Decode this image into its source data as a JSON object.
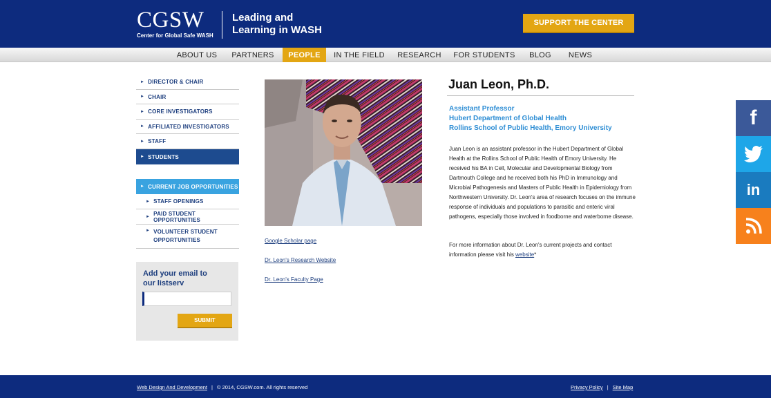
{
  "header": {
    "logo_text": "CGSW",
    "logo_subtitle": "Center for Global Safe WASH",
    "tagline_line1": "Leading and",
    "tagline_line2": "Learning in WASH",
    "support_button": "SUPPORT THE CENTER"
  },
  "nav": {
    "items": [
      {
        "label": "ABOUT US"
      },
      {
        "label": "PARTNERS"
      },
      {
        "label": "PEOPLE"
      },
      {
        "label": "IN THE FIELD"
      },
      {
        "label": "RESEARCH"
      },
      {
        "label": "FOR STUDENTS"
      },
      {
        "label": "BLOG"
      },
      {
        "label": "NEWS"
      }
    ],
    "active": "PEOPLE"
  },
  "sidebar": {
    "people_links": [
      {
        "label": "DIRECTOR & CHAIR"
      },
      {
        "label": "CHAIR"
      },
      {
        "label": "CORE INVESTIGATORS"
      },
      {
        "label": "AFFILIATED INVESTIGATORS"
      },
      {
        "label": "STAFF"
      },
      {
        "label": "STUDENTS"
      }
    ],
    "jobs_heading": "CURRENT JOB OPPORTUNITIES",
    "job_links": [
      {
        "label": "STAFF OPENINGS"
      },
      {
        "label": "PAID STUDENT OPPORTUNITIES"
      },
      {
        "label": "VOLUNTEER STUDENT OPPORTUNITIES"
      }
    ],
    "listserv": {
      "title_line1": "Add your email to",
      "title_line2": "our listserv",
      "input_value": "",
      "submit_label": "SUBMIT"
    }
  },
  "profile": {
    "name": "Juan Leon, Ph.D.",
    "titles": [
      "Assistant Professor",
      "Hubert Department of Global Health",
      "Rollins School of Public Health, Emory University"
    ],
    "bio": "Juan Leon is an assistant professor in the Hubert Department of Global Health at the Rollins School of Public Health of Emory University. He received his BA in Cell, Molecular and Developmental Biology from Dartmouth College and he received both his PhD in Immunology and Microbial Pathogenesis and Masters of Public Health in Epidemiology from Northwestern University. Dr. Leon's area of research focuses on the immune response of individuals and populations to parasitic and enteric viral pathogens, especially those involved in foodborne and waterborne disease.",
    "more_info_prefix": "For more information about Dr. Leon's current projects and contact information please visit his ",
    "more_info_link": "website",
    "more_info_suffix": "*",
    "links": [
      {
        "label": "Google Scholar page"
      },
      {
        "label": "Dr. Leon's Research Website"
      },
      {
        "label": "Dr. Leon's Faculty Page"
      }
    ]
  },
  "social": {
    "facebook": {
      "glyph": "f",
      "color": "#3b5999"
    },
    "twitter": {
      "color": "#1ea6e8"
    },
    "linkedin": {
      "glyph": "in",
      "color": "#1a7bbf"
    },
    "rss": {
      "color": "#f7811c"
    }
  },
  "footer": {
    "design_link": "Web Design And Development",
    "copyright": "© 2014, CGSW.com. All rights reserved",
    "privacy": "Privacy Policy",
    "sitemap": "Site Map",
    "separator": "|"
  }
}
